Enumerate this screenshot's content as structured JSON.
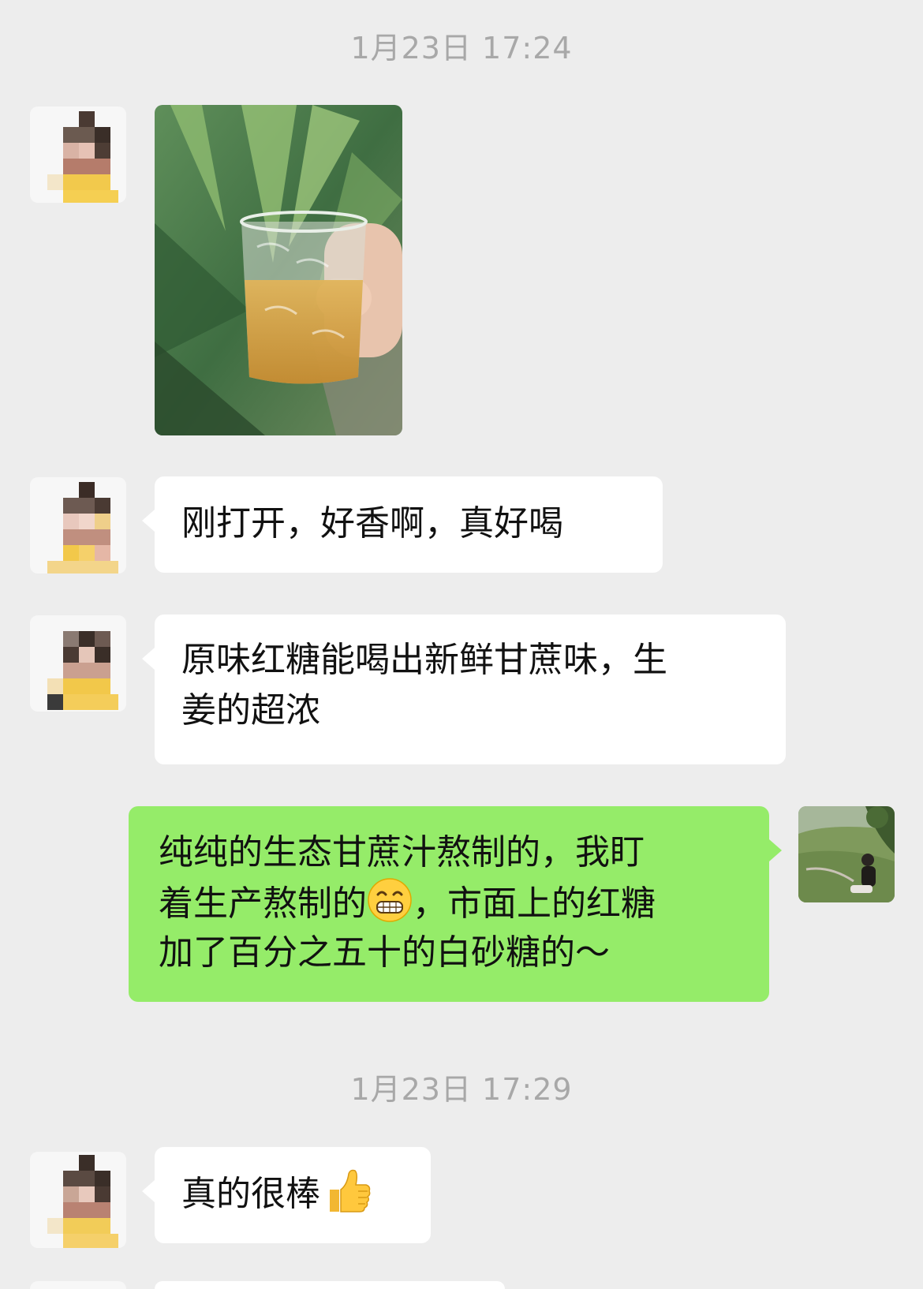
{
  "timestamps": [
    "1月23日 17:24",
    "1月23日 17:29"
  ],
  "messages": {
    "m2": "刚打开，好香啊，真好喝",
    "m3_line1": "原味红糖能喝出新鲜甘蔗味，生",
    "m3_line2": "姜的超浓",
    "m4_line1": "纯纯的生态甘蔗汁熬制的，我盯",
    "m4_line2a": "着生产熬制的",
    "m4_line2b": "，市面上的红糖",
    "m4_line3": "加了百分之五十的白砂糖的～",
    "m5": "真的很棒"
  },
  "icons": {
    "grin_emoji": "grinning-face-emoji",
    "thumbs_emoji": "thumbs-up-emoji"
  },
  "colors": {
    "background": "#ededed",
    "incoming_bubble": "#ffffff",
    "outgoing_bubble": "#95ec69",
    "timestamp": "#a8a8a8"
  }
}
